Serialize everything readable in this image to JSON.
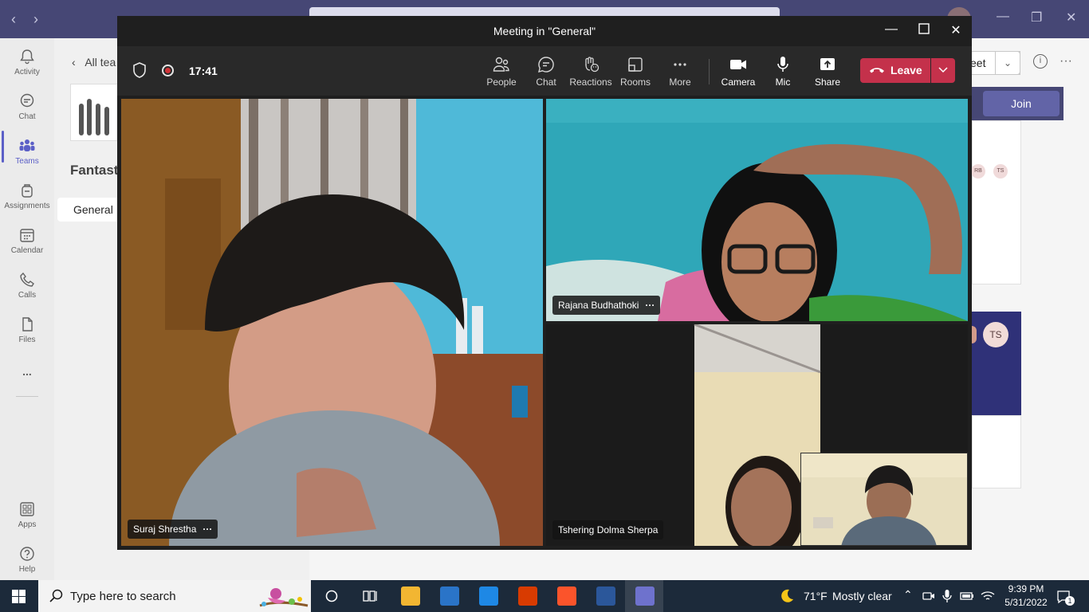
{
  "teams_app": {
    "rail": [
      {
        "label": "Activity",
        "icon": "bell-icon"
      },
      {
        "label": "Chat",
        "icon": "chat-icon"
      },
      {
        "label": "Teams",
        "icon": "teams-icon",
        "active": true
      },
      {
        "label": "Assignments",
        "icon": "backpack-icon"
      },
      {
        "label": "Calendar",
        "icon": "calendar-icon"
      },
      {
        "label": "Calls",
        "icon": "phone-icon"
      },
      {
        "label": "Files",
        "icon": "file-icon"
      },
      {
        "label": "...",
        "icon": "more-icon"
      },
      {
        "label": "Apps",
        "icon": "apps-icon"
      },
      {
        "label": "Help",
        "icon": "help-icon"
      }
    ],
    "back_label": "All tea",
    "team_name": "Fantast",
    "channel": "General",
    "meet_button": "eet",
    "join_button": "Join",
    "avatars": [
      "RB",
      "TS"
    ],
    "meeting_avatar": "TS"
  },
  "meeting": {
    "title": "Meeting in \"General\"",
    "timer": "17:41",
    "tools": [
      {
        "label": "People",
        "icon": "people-icon"
      },
      {
        "label": "Chat",
        "icon": "chat-bubble-icon"
      },
      {
        "label": "Reactions",
        "icon": "reactions-icon"
      },
      {
        "label": "Rooms",
        "icon": "rooms-icon"
      },
      {
        "label": "More",
        "icon": "more-dots-icon"
      },
      {
        "label": "Camera",
        "icon": "camera-icon"
      },
      {
        "label": "Mic",
        "icon": "mic-icon"
      },
      {
        "label": "Share",
        "icon": "share-icon"
      }
    ],
    "leave_label": "Leave",
    "participants": [
      {
        "name": "Suraj Shrestha",
        "dots": "···"
      },
      {
        "name": "Rajana Budhathoki",
        "dots": "···"
      },
      {
        "name": "Tshering Dolma Sherpa"
      }
    ]
  },
  "taskbar": {
    "search_placeholder": "Type here to search",
    "weather_temp": "71°F",
    "weather_desc": "Mostly clear",
    "time": "9:39 PM",
    "date": "5/31/2022",
    "notification_count": "1"
  },
  "colors": {
    "teams_purple": "#464775",
    "leave_red": "#c4314b",
    "meeting_bg": "#1f1f1f",
    "toolbar_bg": "#292929"
  }
}
